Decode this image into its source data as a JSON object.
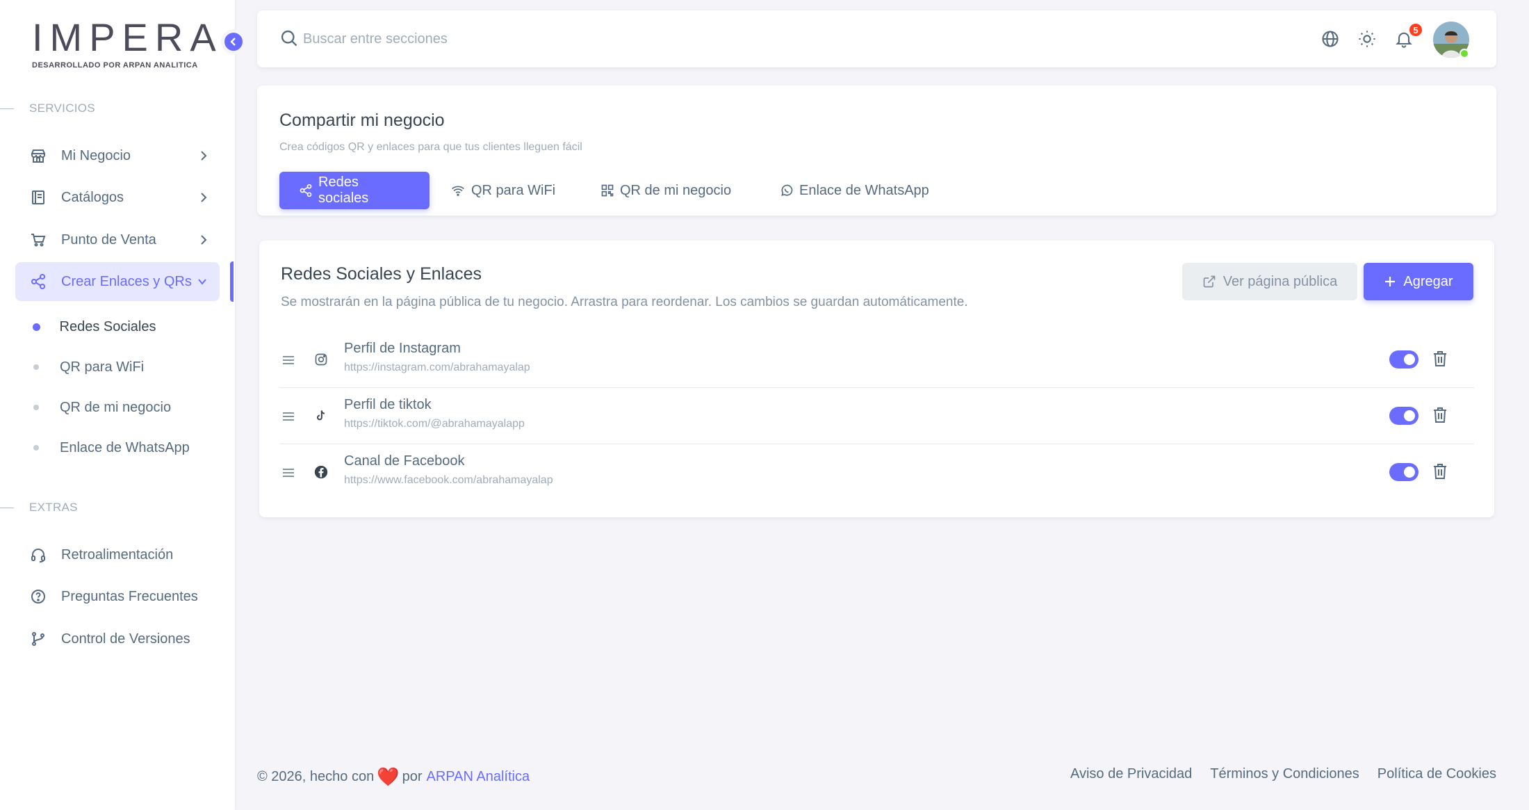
{
  "brand": {
    "name": "IMPERA",
    "tagline": "DESARROLLADO POR ARPAN ANALITICA"
  },
  "sidebar": {
    "sections": [
      {
        "title": "SERVICIOS"
      },
      {
        "title": "EXTRAS"
      }
    ],
    "items": [
      {
        "label": "Mi Negocio",
        "icon": "store-icon"
      },
      {
        "label": "Catálogos",
        "icon": "book-icon"
      },
      {
        "label": "Punto de Venta",
        "icon": "cart-icon"
      },
      {
        "label": "Crear Enlaces y QRs",
        "icon": "share-icon",
        "active": true
      }
    ],
    "sub_items": [
      {
        "label": "Redes Sociales",
        "active": true
      },
      {
        "label": "QR para WiFi"
      },
      {
        "label": "QR de mi negocio"
      },
      {
        "label": "Enlace de WhatsApp"
      }
    ],
    "extras": [
      {
        "label": "Retroalimentación",
        "icon": "headset-icon"
      },
      {
        "label": "Preguntas Frecuentes",
        "icon": "help-circle-icon"
      },
      {
        "label": "Control de Versiones",
        "icon": "git-branch-icon"
      }
    ]
  },
  "topbar": {
    "search_placeholder": "Buscar entre secciones",
    "notifications_count": "5"
  },
  "share": {
    "title": "Compartir mi negocio",
    "subtitle": "Crea códigos QR y enlaces para que tus clientes lleguen fácil",
    "tabs": [
      {
        "label": "Redes sociales",
        "active": true
      },
      {
        "label": "QR para WiFi"
      },
      {
        "label": "QR de mi negocio"
      },
      {
        "label": "Enlace de WhatsApp"
      }
    ]
  },
  "links": {
    "title": "Redes Sociales y Enlaces",
    "subtitle": "Se mostrarán en la página pública de tu negocio. Arrastra para reordenar. Los cambios se guardan automáticamente.",
    "view_public_label": "Ver página pública",
    "add_label": "Agregar",
    "rows": [
      {
        "name": "Perfil de Instagram",
        "url": "https://instagram.com/abrahamayalap",
        "icon": "instagram-icon",
        "enabled": true
      },
      {
        "name": "Perfil de tiktok",
        "url": "https://tiktok.com/@abrahamayalapp",
        "icon": "tiktok-icon",
        "enabled": true
      },
      {
        "name": "Canal de Facebook",
        "url": "https://www.facebook.com/abrahamayalap",
        "icon": "facebook-icon",
        "enabled": true
      }
    ]
  },
  "footer": {
    "copyright": "© 2026, hecho con",
    "heart": "❤️",
    "by": "por",
    "company": "ARPAN Analítica",
    "links": [
      "Aviso de Privacidad",
      "Términos y Condiciones",
      "Política de Cookies"
    ]
  },
  "colors": {
    "primary": "#696cff",
    "background": "#f5f5f9",
    "text": "#566a7f",
    "muted": "#a1acb8",
    "danger": "#ff3e1d",
    "online": "#71dd37"
  }
}
